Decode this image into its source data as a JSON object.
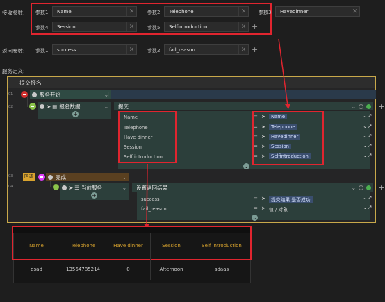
{
  "receive": {
    "label": "接收参数:",
    "params": [
      {
        "label": "参数1",
        "value": "Name"
      },
      {
        "label": "参数2",
        "value": "Telephone"
      },
      {
        "label": "参数3",
        "value": "Havedinner"
      },
      {
        "label": "参数4",
        "value": "Session"
      },
      {
        "label": "参数5",
        "value": "Selfintroduction"
      }
    ]
  },
  "returns": {
    "label": "返回参数:",
    "params": [
      {
        "label": "参数1",
        "value": "success"
      },
      {
        "label": "参数2",
        "value": "fail_reason"
      }
    ]
  },
  "service_def_label": "服务定义:",
  "panel_title": "提交报名",
  "line_numbers": [
    "01",
    "02",
    "03",
    "04"
  ],
  "nodes": {
    "start": "服务开始",
    "submit_data": "报名数据",
    "submit": "提交",
    "complete_tag": "回调",
    "complete": "完成",
    "current_service": "当前服务",
    "set_result": "设置返回结果"
  },
  "submit_fields": [
    {
      "key": "Name",
      "value": "Name"
    },
    {
      "key": "Telephone",
      "value": "Telephone"
    },
    {
      "key": "Have dinner",
      "value": "Havedinner"
    },
    {
      "key": "Session",
      "value": "Session"
    },
    {
      "key": "Self introduction",
      "value": "Selfintroduction"
    }
  ],
  "result_fields": [
    {
      "key": "success",
      "value": "提交结果.是否成功"
    },
    {
      "key": "fail_reason",
      "value": "值 / 对象"
    }
  ],
  "table": {
    "headers": [
      "Name",
      "Telephone",
      "Have dinner",
      "Session",
      "Self introduction"
    ],
    "rows": [
      [
        "dsad",
        "13564785214",
        "0",
        "Afternoon",
        "sdaas"
      ]
    ]
  },
  "colors": {
    "accent_red": "#e0252f",
    "panel_border": "#c8a84a",
    "header_text": "#d8a32e",
    "chip": "#3a4e6e"
  }
}
